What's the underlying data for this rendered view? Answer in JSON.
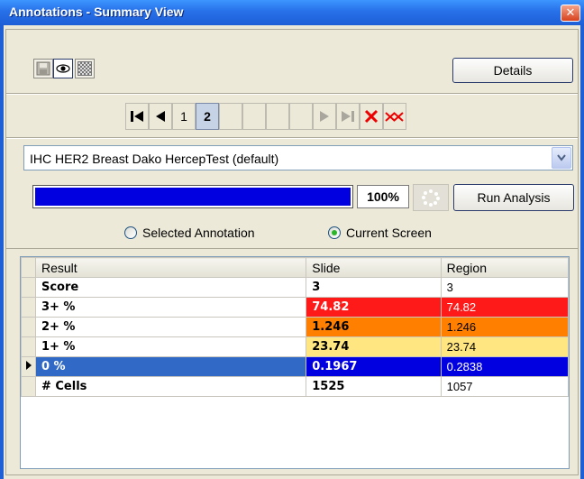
{
  "window": {
    "title": "Annotations - Summary View",
    "close_glyph": "✕"
  },
  "toolbar": {
    "details_label": "Details",
    "icons": [
      "save-icon",
      "eye-icon",
      "grid-pattern-icon"
    ]
  },
  "navigation": {
    "pages": [
      "1",
      "2"
    ],
    "current_page": "2",
    "icons": [
      "first-page-icon",
      "previous-page-icon",
      "next-page-icon",
      "last-page-icon",
      "delete-icon",
      "delete-all-icon"
    ]
  },
  "algorithm": {
    "selected": "IHC HER2 Breast Dako HercepTest (default)"
  },
  "analysis": {
    "progress_fraction": 1.0,
    "progress_label": "100%",
    "run_label": "Run Analysis"
  },
  "scope": {
    "options": [
      {
        "label": "Selected Annotation",
        "checked": false
      },
      {
        "label": "Current Screen",
        "checked": true
      }
    ]
  },
  "results": {
    "columns": [
      "Result",
      "Slide",
      "Region"
    ],
    "rows": [
      {
        "result": "Score",
        "slide": "3",
        "region": "3",
        "color": "#ffffff"
      },
      {
        "result": "3+ %",
        "slide": "74.82",
        "region": "74.82",
        "color": "#ff1a1a"
      },
      {
        "result": "2+ %",
        "slide": "1.246",
        "region": "1.246",
        "color": "#ff8000"
      },
      {
        "result": "1+ %",
        "slide": "23.74",
        "region": "23.74",
        "color": "#ffe680"
      },
      {
        "result": "0 %",
        "slide": "0.1967",
        "region": "0.2838",
        "color": "#0000e0",
        "selected": true
      },
      {
        "result": "# Cells",
        "slide": "1525",
        "region": "1057",
        "color": "#ffffff"
      }
    ]
  },
  "colors": {
    "title_bar": "#2770e8",
    "selection": "#3169c6",
    "progress": "#0000e0"
  }
}
